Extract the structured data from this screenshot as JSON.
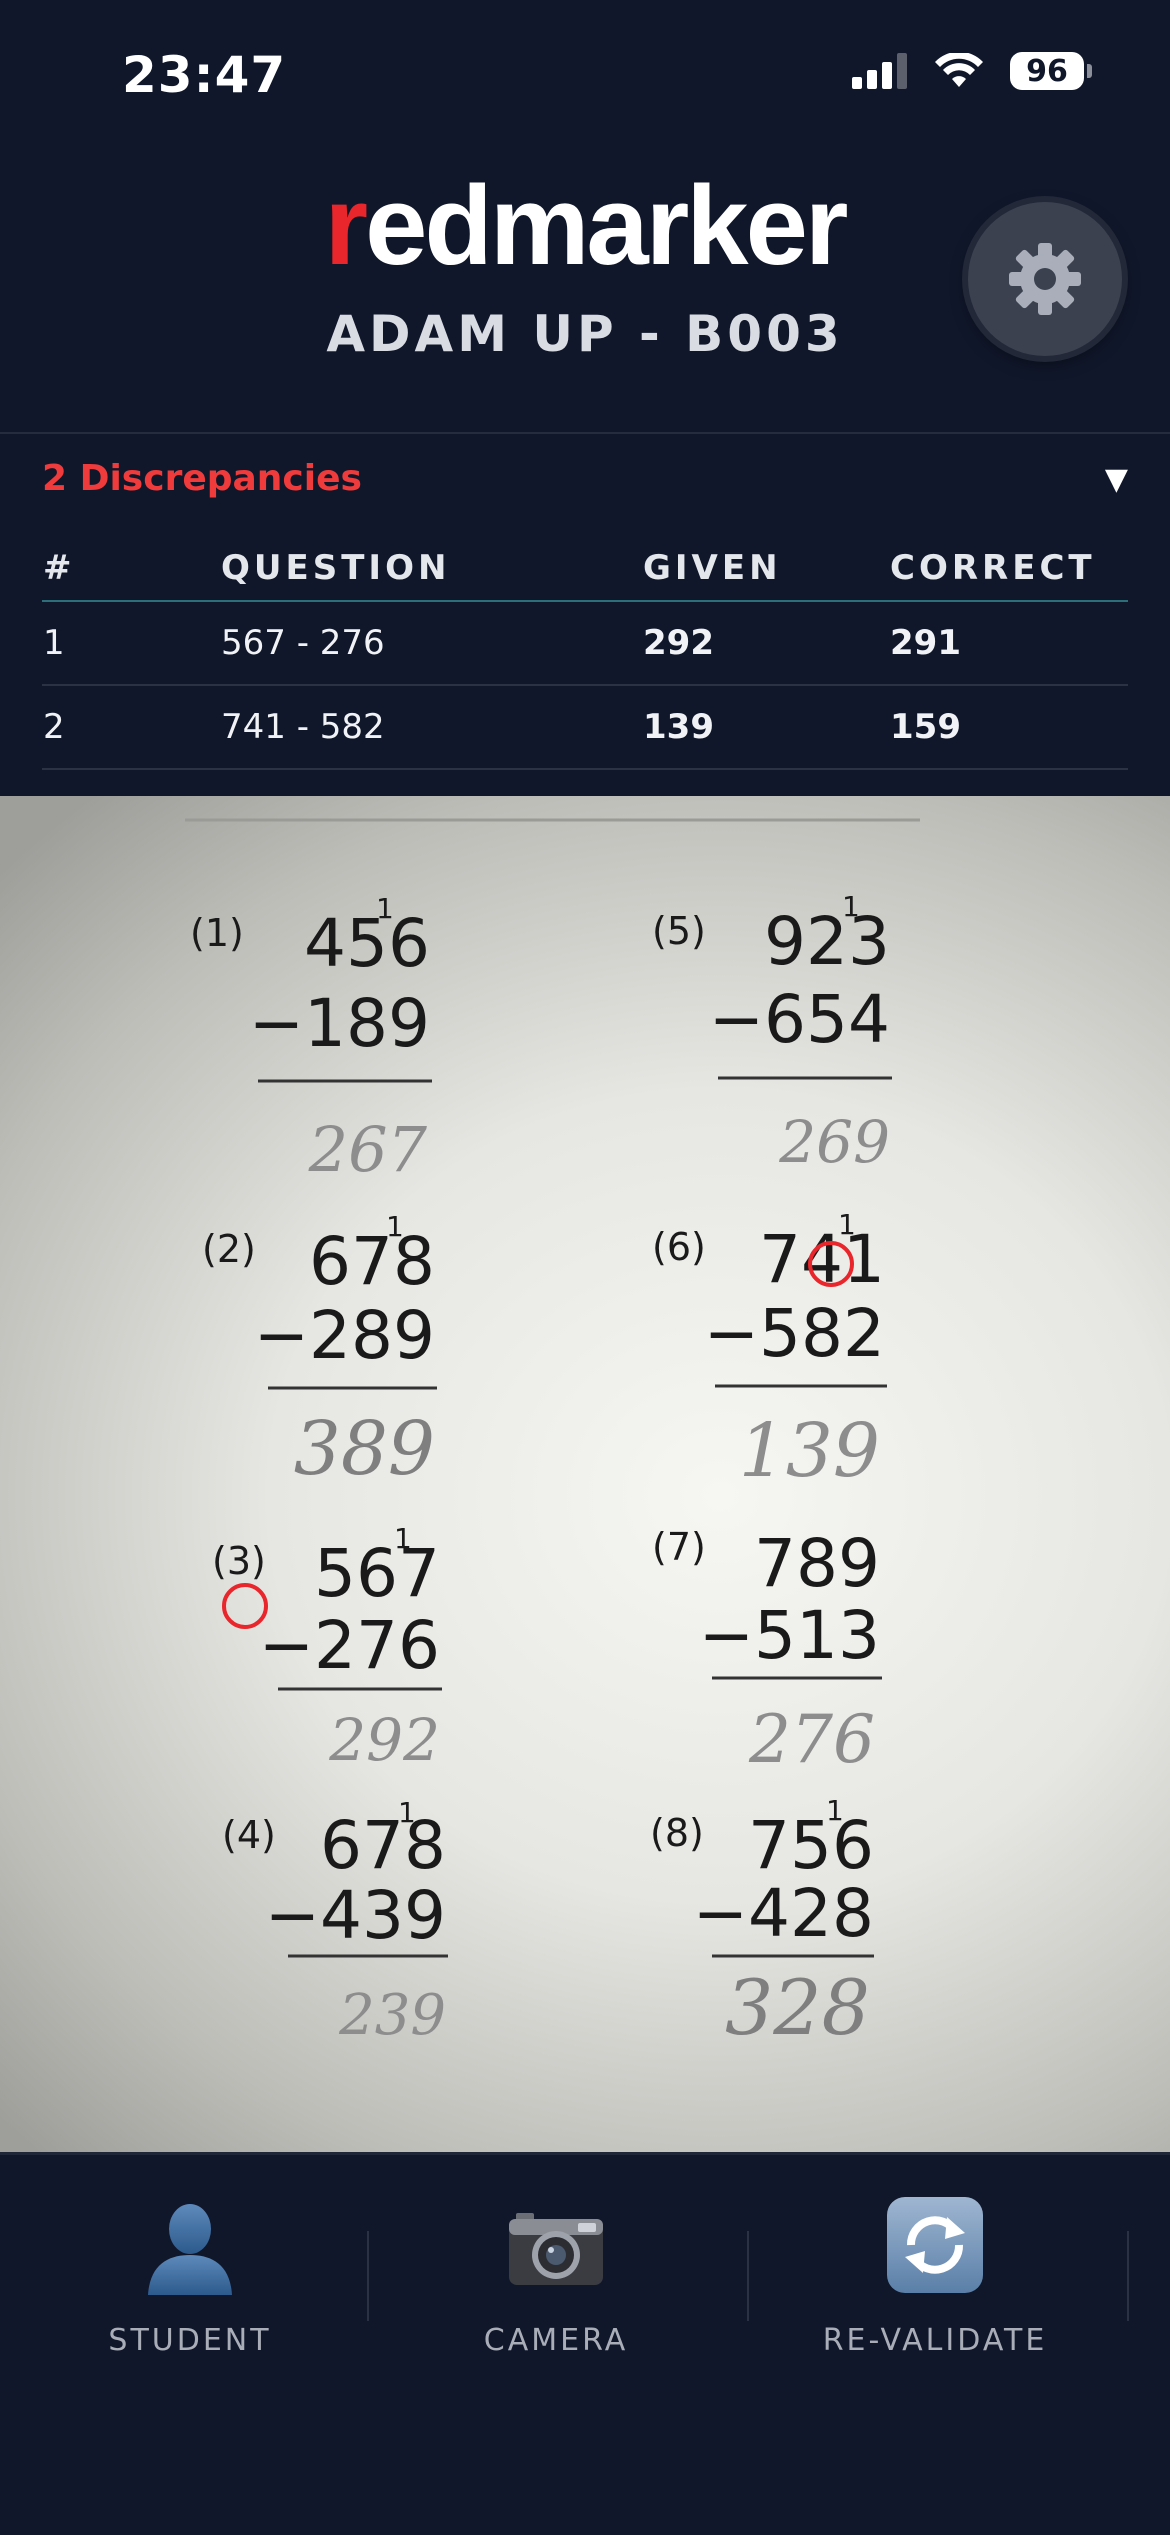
{
  "status_bar": {
    "time": "23:47",
    "battery": "96"
  },
  "header": {
    "brand_first": "r",
    "brand_rest": "edmarker",
    "subtitle": "ADAM UP - B003"
  },
  "discrepancies": {
    "title": "2 Discrepancies",
    "toggle": "▼",
    "columns": [
      "#",
      "QUESTION",
      "GIVEN",
      "CORRECT"
    ],
    "rows": [
      {
        "num": "1",
        "question": "567 - 276",
        "given": "292",
        "correct": "291"
      },
      {
        "num": "2",
        "question": "741 - 582",
        "given": "139",
        "correct": "159"
      }
    ]
  },
  "worksheet": {
    "problems": [
      {
        "label": "(1)",
        "carry": "1",
        "top": "456",
        "bottom": "−189",
        "answer": "267"
      },
      {
        "label": "(2)",
        "carry": "1",
        "top": "678",
        "bottom": "−289",
        "answer": "389"
      },
      {
        "label": "(3)",
        "carry": "1",
        "top": "567",
        "bottom": "−276",
        "answer": "292"
      },
      {
        "label": "(4)",
        "carry": "1",
        "top": "678",
        "bottom": "−439",
        "answer": "239"
      },
      {
        "label": "(5)",
        "carry": "1",
        "top": "923",
        "bottom": "−654",
        "answer": "269"
      },
      {
        "label": "(6)",
        "carry": "1",
        "top": "741",
        "bottom": "−582",
        "answer": "139"
      },
      {
        "label": "(7)",
        "carry": "",
        "top": "789",
        "bottom": "−513",
        "answer": "276"
      },
      {
        "label": "(8)",
        "carry": "1",
        "top": "756",
        "bottom": "−428",
        "answer": "328"
      }
    ]
  },
  "tabs": [
    {
      "label": "STUDENT",
      "icon": "student-icon"
    },
    {
      "label": "CAMERA",
      "icon": "camera-icon"
    },
    {
      "label": "RE-VALIDATE",
      "icon": "refresh-icon"
    }
  ],
  "colors": {
    "accent_red": "#ef3b3b",
    "accent_green": "#35c997",
    "background": "#10172a"
  }
}
